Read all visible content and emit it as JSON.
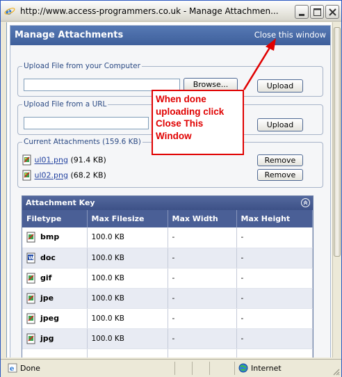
{
  "window": {
    "title": "http://www.access-programmers.co.uk - Manage Attachmen..."
  },
  "header": {
    "title": "Manage Attachments",
    "close_link": "Close this window"
  },
  "upload_computer": {
    "legend": "Upload File from your Computer",
    "input_value": "",
    "browse_label": "Browse...",
    "upload_label": "Upload"
  },
  "upload_url": {
    "legend": "Upload File from a URL",
    "input_value": "",
    "upload_label": "Upload"
  },
  "current": {
    "legend": "Current Attachments (159.6 KB)",
    "items": [
      {
        "name": "ul01.png",
        "size": "(91.4 KB)",
        "remove_label": "Remove"
      },
      {
        "name": "ul02.png",
        "size": "(68.2 KB)",
        "remove_label": "Remove"
      }
    ]
  },
  "key": {
    "title": "Attachment Key",
    "columns": [
      "Filetype",
      "Max Filesize",
      "Max Width",
      "Max Height"
    ],
    "rows": [
      {
        "type": "bmp",
        "size": "100.0 KB",
        "width": "-",
        "height": "-"
      },
      {
        "type": "doc",
        "size": "100.0 KB",
        "width": "-",
        "height": "-"
      },
      {
        "type": "gif",
        "size": "100.0 KB",
        "width": "-",
        "height": "-"
      },
      {
        "type": "jpe",
        "size": "100.0 KB",
        "width": "-",
        "height": "-"
      },
      {
        "type": "jpeg",
        "size": "100.0 KB",
        "width": "-",
        "height": "-"
      },
      {
        "type": "jpg",
        "size": "100.0 KB",
        "width": "-",
        "height": "-"
      }
    ]
  },
  "status": {
    "text": "Done",
    "zone": "Internet"
  },
  "annotation": {
    "lines": [
      "When done",
      "uploading click",
      "Close This",
      "Window"
    ],
    "color": "#e00000"
  },
  "icons": {
    "title": "ie-icon",
    "file": "file-icon",
    "doc": "word-document-icon",
    "zone": "globe-icon"
  }
}
